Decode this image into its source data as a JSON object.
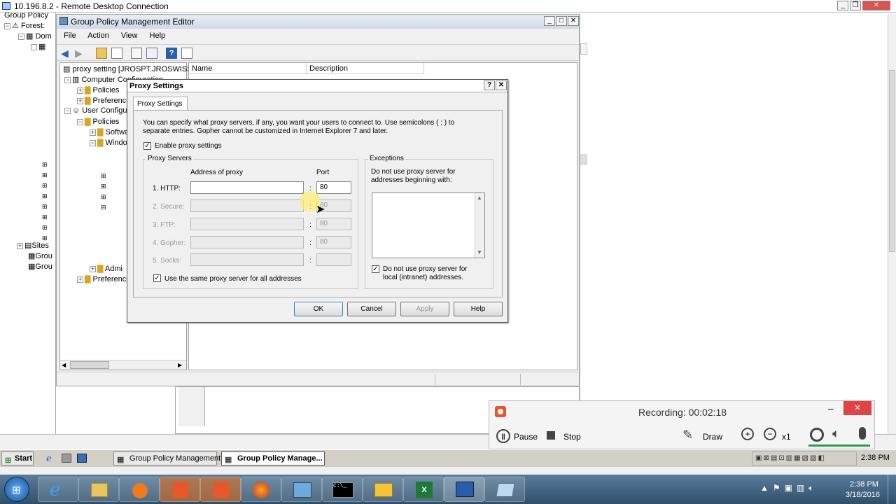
{
  "rdp": {
    "title": "10.196.8.2 - Remote Desktop Connection"
  },
  "gpm_tree": [
    {
      "label": "Group Policy",
      "pm": ""
    },
    {
      "label": "Forest:",
      "pm": "−"
    },
    {
      "label": "Dom",
      "pm": "−"
    },
    {
      "label": "",
      "pm": ""
    },
    {
      "label": "Sites",
      "pm": "+"
    },
    {
      "label": "Grou",
      "pm": ""
    },
    {
      "label": "Grou",
      "pm": ""
    }
  ],
  "gpe": {
    "title": "Group Policy Management Editor",
    "menu": [
      "File",
      "Action",
      "View",
      "Help"
    ],
    "tree": [
      {
        "label": "proxy setting [JROSPT.JROSWISS",
        "pm": "",
        "indent": 0
      },
      {
        "label": "Computer Configuration",
        "pm": "−",
        "indent": 0
      },
      {
        "label": "Policies",
        "pm": "+",
        "indent": 1
      },
      {
        "label": "Preferences",
        "pm": "+",
        "indent": 1
      },
      {
        "label": "User Configuration",
        "pm": "−",
        "indent": 0
      },
      {
        "label": "Policies",
        "pm": "−",
        "indent": 1
      },
      {
        "label": "Software",
        "pm": "+",
        "indent": 2
      },
      {
        "label": "Windows",
        "pm": "−",
        "indent": 2
      },
      {
        "label": "Admi",
        "pm": "+",
        "indent": 2
      },
      {
        "label": "Preferences",
        "pm": "+",
        "indent": 1
      }
    ],
    "columns": [
      "Name",
      "Description"
    ]
  },
  "dialog": {
    "title": "Proxy Settings",
    "tab": "Proxy Settings",
    "intro_line1": "You can specify what proxy servers, if any, you want your users to connect to. Use semicolons ( ; ) to",
    "intro_line2": "separate entries. Gopher cannot be customized in Internet Explorer 7 and later.",
    "enable_label": "Enable proxy settings",
    "servers_group": "Proxy Servers",
    "address_header": "Address of proxy",
    "port_header": "Port",
    "rows": [
      {
        "label": "1. HTTP:",
        "address": "",
        "port": "80",
        "enabled": true
      },
      {
        "label": "2. Secure:",
        "address": "",
        "port": "80",
        "enabled": false
      },
      {
        "label": "3. FTP:",
        "address": "",
        "port": "80",
        "enabled": false
      },
      {
        "label": "4. Gopher:",
        "address": "",
        "port": "80",
        "enabled": false
      },
      {
        "label": "5. Socks:",
        "address": "",
        "port": "",
        "enabled": false
      }
    ],
    "same_proxy_label": "Use the same proxy server for all addresses",
    "exceptions_group": "Exceptions",
    "exceptions_line1": "Do not use proxy server for",
    "exceptions_line2": "addresses beginning with:",
    "local_line1": "Do not use proxy server for",
    "local_line2": "local (intranet) addresses.",
    "buttons": {
      "ok": "OK",
      "cancel": "Cancel",
      "apply": "Apply",
      "help": "Help"
    }
  },
  "recorder": {
    "status": "Recording:  00:02:18",
    "pause": "Pause",
    "stop": "Stop",
    "draw": "Draw",
    "zoom": "x1"
  },
  "taskbar": {
    "start": "Start",
    "tasks": [
      "Group Policy Management",
      "Group Policy Manage..."
    ],
    "time": "2:38 PM"
  },
  "win7": {
    "time": "2:38 PM",
    "date": "3/18/2016"
  },
  "colors": {
    "accent": "#0a246a",
    "dialog_bg": "#f0f0f0",
    "record": "#e8562a",
    "close_red": "#e04343",
    "taskbar": "#3a5f80"
  }
}
